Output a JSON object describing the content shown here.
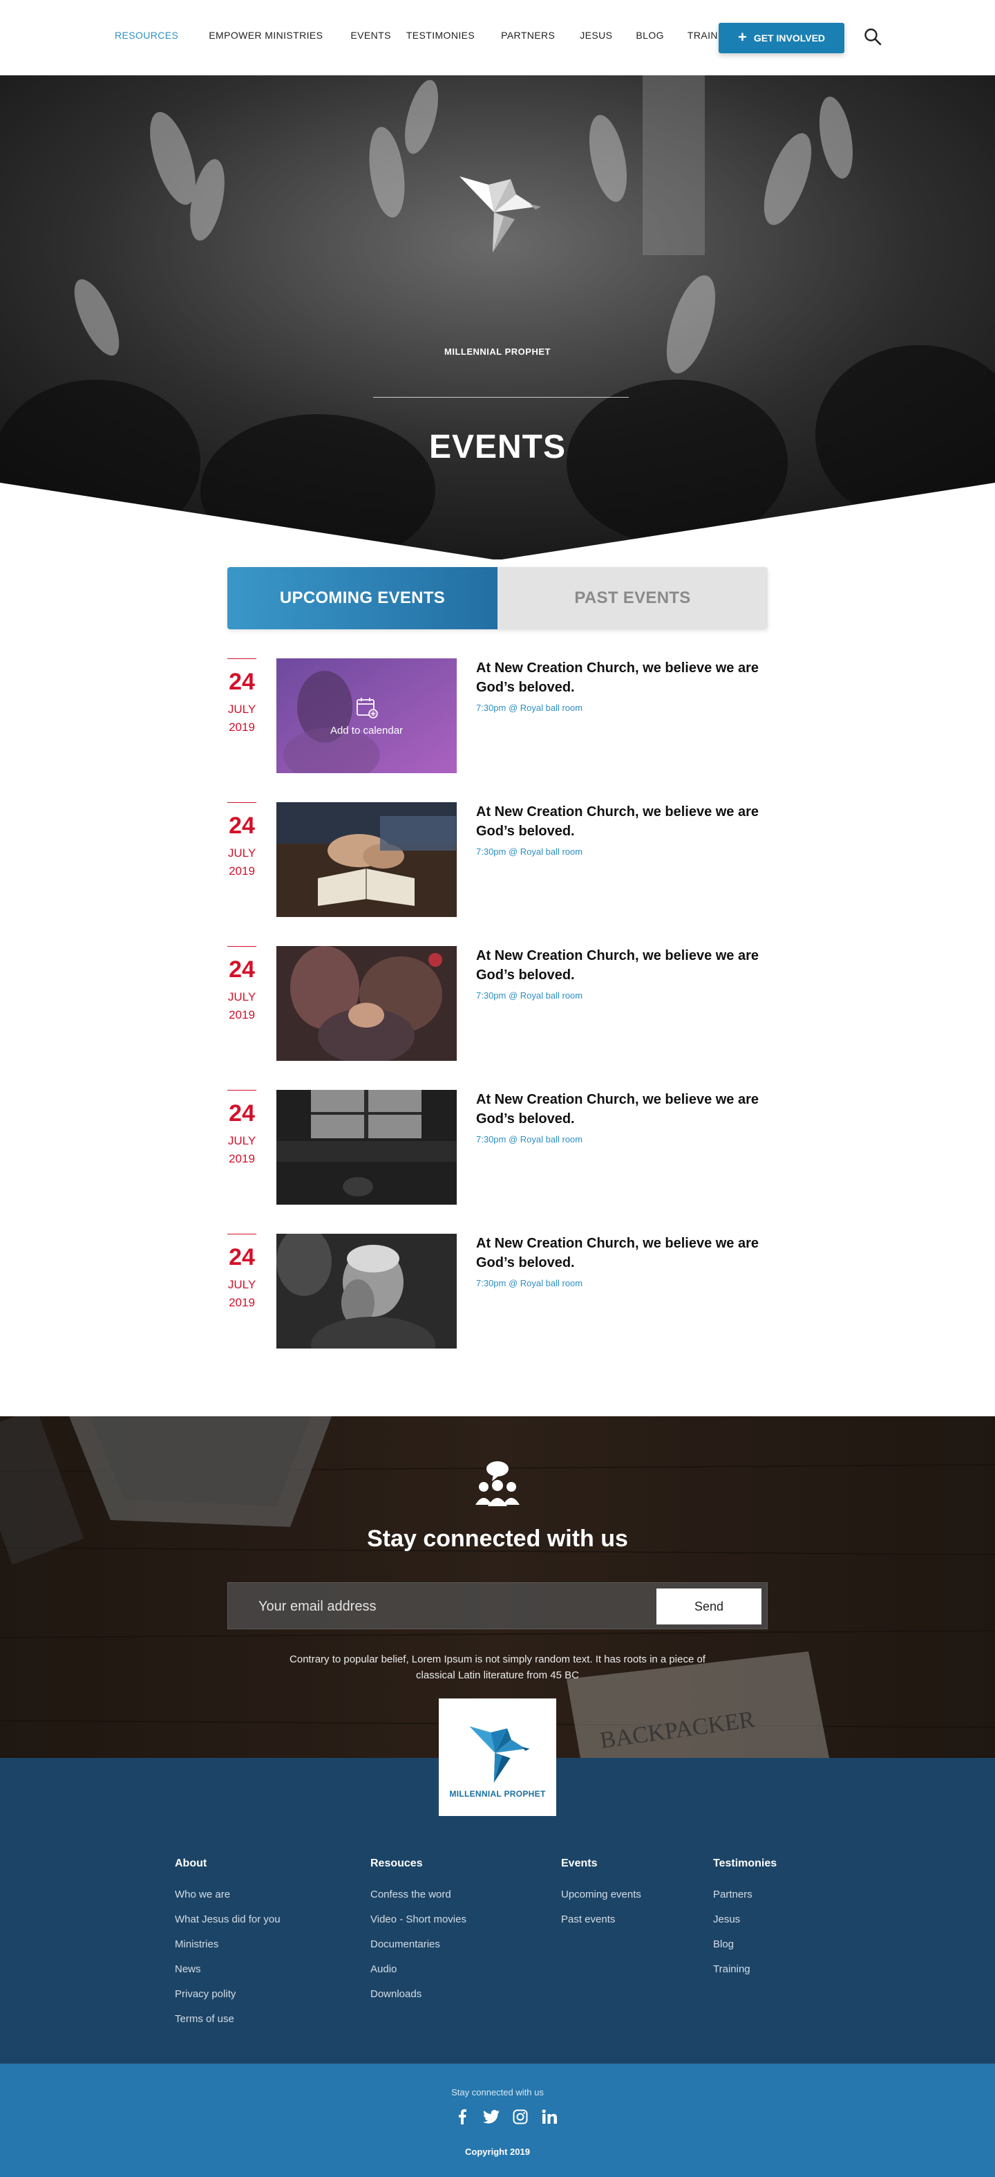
{
  "nav": {
    "links": [
      {
        "label": "RESOURCES",
        "active": true
      },
      {
        "label": "EMPOWER MINISTRIES",
        "active": false
      },
      {
        "label": "EVENTS",
        "active": false
      },
      {
        "label": "TESTIMONIES",
        "active": false
      },
      {
        "label": "PARTNERS",
        "active": false
      },
      {
        "label": "JESUS",
        "active": false
      },
      {
        "label": "BLOG",
        "active": false
      },
      {
        "label": "TRAINING",
        "active": false
      }
    ],
    "cta_label": "GET INVOLVED"
  },
  "hero": {
    "brand": "MILLENNIAL PROPHET",
    "title": "EVENTS"
  },
  "tabs": {
    "upcoming": "UPCOMING EVENTS",
    "past": "PAST EVENTS"
  },
  "events": [
    {
      "day": "24",
      "month": "JULY",
      "year": "2019",
      "title": "At New Creation Church, we believe we are God’s beloved.",
      "meta": "7:30pm @ Royal ball room",
      "overlay": "Add to calendar"
    },
    {
      "day": "24",
      "month": "JULY",
      "year": "2019",
      "title": "At New Creation Church, we believe we are God’s beloved.",
      "meta": "7:30pm @ Royal ball room"
    },
    {
      "day": "24",
      "month": "JULY",
      "year": "2019",
      "title": "At New Creation Church, we believe we are God’s beloved.",
      "meta": "7:30pm @ Royal ball room"
    },
    {
      "day": "24",
      "month": "JULY",
      "year": "2019",
      "title": "At New Creation Church, we believe we are God’s beloved.",
      "meta": "7:30pm @ Royal ball room"
    },
    {
      "day": "24",
      "month": "JULY",
      "year": "2019",
      "title": "At New Creation Church, we believe we are God’s beloved.",
      "meta": "7:30pm @ Royal ball room"
    }
  ],
  "newsletter": {
    "title": "Stay connected with us",
    "placeholder": "Your email address",
    "send": "Send",
    "text": "Contrary to popular belief, Lorem Ipsum is not simply random text. It has roots in a piece of classical Latin literature from 45 BC"
  },
  "footer": {
    "logo_text": "MILLENNIAL PROPHET",
    "columns": [
      {
        "heading": "About",
        "items": [
          "Who we are",
          "What Jesus did for you",
          "Ministries",
          "News",
          "Privacy polity",
          "Terms of use"
        ]
      },
      {
        "heading": "Resouces",
        "items": [
          "Confess the word",
          "Video - Short movies",
          "Documentaries",
          "Audio",
          "Downloads"
        ]
      },
      {
        "heading": "Events",
        "items": [
          "Upcoming events",
          "Past events"
        ]
      },
      {
        "heading": "Testimonies",
        "items": [
          "Partners",
          "Jesus",
          "Blog",
          "Training"
        ]
      }
    ],
    "stay_connected": "Stay connected with us",
    "social": [
      "facebook-icon",
      "twitter-icon",
      "instagram-icon",
      "linkedin-icon"
    ],
    "copyright": "Copyright 2019"
  },
  "colors": {
    "accent": "#2d8ec4",
    "cta": "#1a7fb3",
    "date_red": "#d5102a",
    "footer_dark": "#1c4466",
    "footer_light": "#2677ad"
  }
}
